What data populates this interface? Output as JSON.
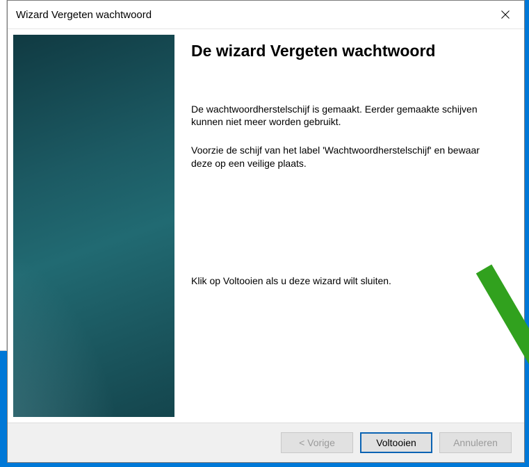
{
  "window": {
    "title": "Wizard Vergeten wachtwoord"
  },
  "content": {
    "heading": "De wizard Vergeten wachtwoord",
    "para1": "De wachtwoordherstelschijf is gemaakt. Eerder gemaakte schijven kunnen niet meer worden gebruikt.",
    "para2": "Voorzie de schijf van het label 'Wachtwoordherstelschijf' en bewaar deze op een veilige plaats.",
    "para3": "Klik op Voltooien als u deze wizard wilt sluiten."
  },
  "buttons": {
    "back": "< Vorige",
    "finish": "Voltooien",
    "cancel": "Annuleren"
  },
  "annotation": {
    "arrow_color": "#31a11e"
  }
}
